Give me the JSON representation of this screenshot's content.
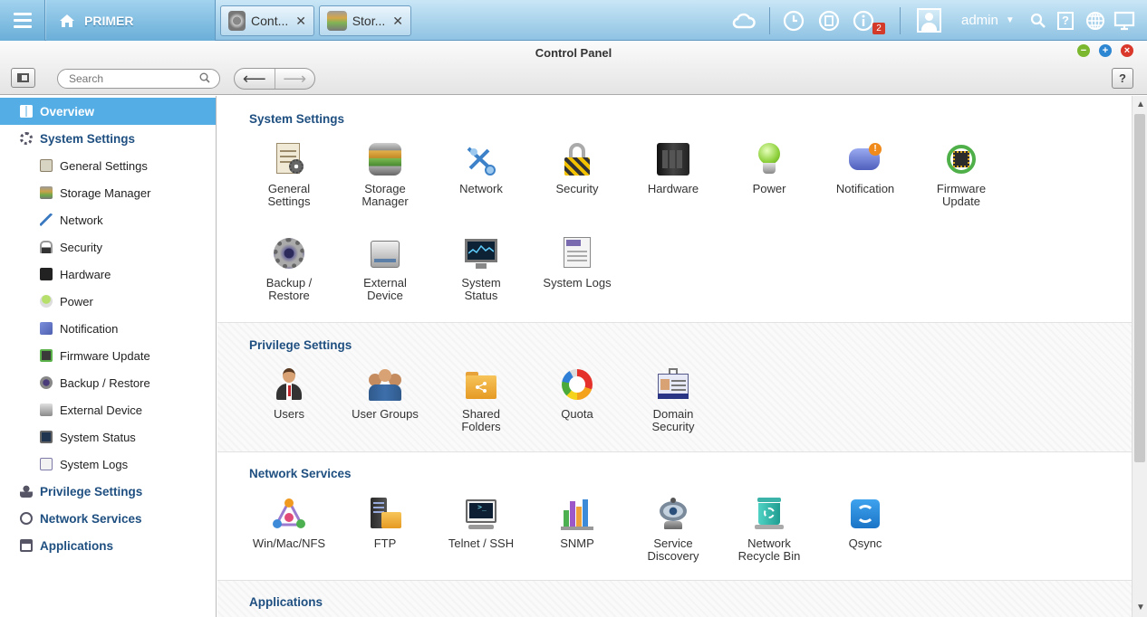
{
  "topbar": {
    "brand": "PRIMER",
    "tabs": [
      {
        "label": "Cont...",
        "close": "✕",
        "icon": "gear-icon"
      },
      {
        "label": "Stor...",
        "close": "✕",
        "icon": "storage-icon"
      }
    ],
    "user": "admin",
    "notification_count": "2"
  },
  "window": {
    "title": "Control Panel"
  },
  "toolbar": {
    "search_placeholder": "Search",
    "help_label": "?"
  },
  "sidebar": {
    "overview": "Overview",
    "system_settings": "System Settings",
    "system_items": [
      "General Settings",
      "Storage Manager",
      "Network",
      "Security",
      "Hardware",
      "Power",
      "Notification",
      "Firmware Update",
      "Backup / Restore",
      "External Device",
      "System Status",
      "System Logs"
    ],
    "privilege_settings": "Privilege Settings",
    "network_services": "Network Services",
    "applications": "Applications"
  },
  "main": {
    "sections": [
      {
        "title": "System Settings",
        "items": [
          "General\nSettings",
          "Storage\nManager",
          "Network",
          "Security",
          "Hardware",
          "Power",
          "Notification",
          "Firmware\nUpdate",
          "Backup /\nRestore",
          "External\nDevice",
          "System\nStatus",
          "System Logs"
        ]
      },
      {
        "title": "Privilege Settings",
        "items": [
          "Users",
          "User Groups",
          "Shared\nFolders",
          "Quota",
          "Domain\nSecurity"
        ]
      },
      {
        "title": "Network Services",
        "items": [
          "Win/Mac/NFS",
          "FTP",
          "Telnet / SSH",
          "SNMP",
          "Service\nDiscovery",
          "Network\nRecycle Bin",
          "Qsync"
        ]
      },
      {
        "title": "Applications",
        "items": []
      }
    ]
  },
  "colors": {
    "accent": "#55ade6",
    "heading": "#1e4f80",
    "topbar": "#8fc3e3"
  }
}
